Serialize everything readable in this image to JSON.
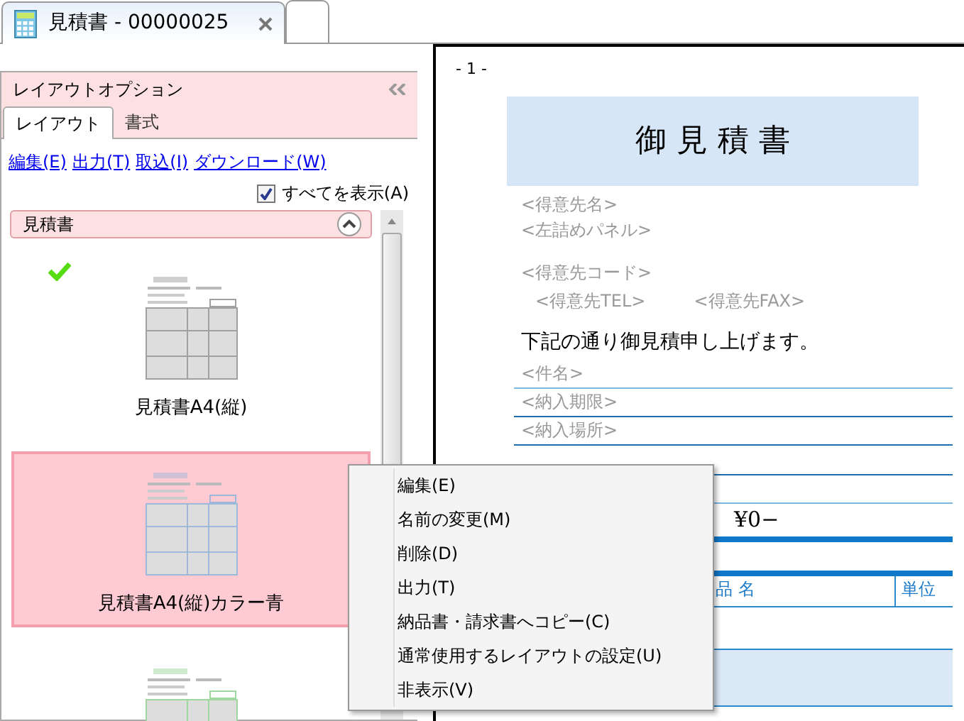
{
  "tabs": [
    {
      "title": "見積書 - 00000025",
      "selected": true
    },
    {
      "selected": false
    }
  ],
  "panel": {
    "title": "レイアウトオプション",
    "tabs": [
      {
        "label": "レイアウト",
        "selected": true
      },
      {
        "label": "書式",
        "selected": false
      }
    ],
    "links": [
      "編集(E)",
      "出力(T)",
      "取込(I)",
      "ダウンロード(W)"
    ],
    "show_all": {
      "label": "すべてを表示(A)",
      "checked": true
    },
    "group": {
      "title": "見積書",
      "expanded": true
    },
    "layouts": [
      {
        "name": "見積書A4(縦)",
        "default": true,
        "selected": false,
        "color": "#a0a0a0"
      },
      {
        "name": "見積書A4(縦)カラー青",
        "default": false,
        "selected": true,
        "color": "#9db8d8"
      },
      {
        "default": false,
        "selected": false,
        "color": "#9ed89e"
      }
    ]
  },
  "preview": {
    "page_number": "- 1 -",
    "title": "御 見 積 書",
    "customer_fields": [
      "<得意先名>",
      "<左詰めパネル>"
    ],
    "code_field": "<得意先コード>",
    "contact_fields": [
      "<得意先TEL>",
      "<得意先FAX>"
    ],
    "message": "下記の通り御見積申し上げます。",
    "lined_fields": [
      "<件名>",
      "<納入期限>",
      "<納入場所>"
    ],
    "amount": "¥0−",
    "columns": [
      "品 名",
      "単位"
    ]
  },
  "context_menu": {
    "items": [
      "編集(E)",
      "名前の変更(M)",
      "削除(D)",
      "出力(T)",
      "納品書・請求書へコピー(C)",
      "通常使用するレイアウトの設定(U)",
      "非表示(V)"
    ]
  }
}
